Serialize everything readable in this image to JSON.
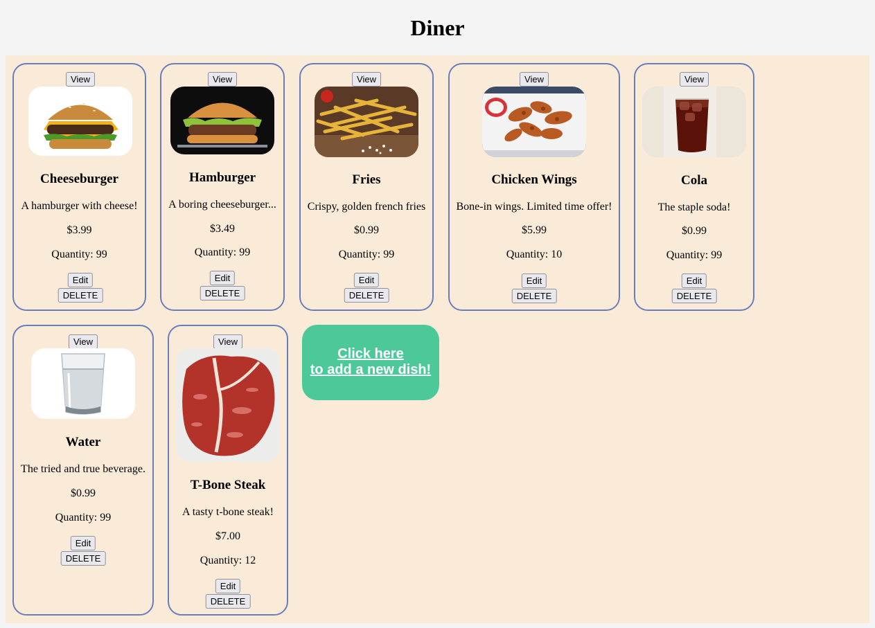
{
  "page": {
    "title": "Diner"
  },
  "buttons": {
    "view": "View",
    "edit": "Edit",
    "delete": "DELETE"
  },
  "dishes": [
    {
      "name": "Cheeseburger",
      "description": "A hamburger with cheese!",
      "price": "$3.99",
      "quantity_label": "Quantity:",
      "quantity": "99",
      "image": "cheeseburger-image"
    },
    {
      "name": "Hamburger",
      "description": "A boring cheeseburger...",
      "price": "$3.49",
      "quantity_label": "Quantity:",
      "quantity": "99",
      "image": "hamburger-image"
    },
    {
      "name": "Fries",
      "description": "Crispy, golden french fries",
      "price": "$0.99",
      "quantity_label": "Quantity:",
      "quantity": "99",
      "image": "fries-image"
    },
    {
      "name": "Chicken Wings",
      "description": "Bone-in wings. Limited time offer!",
      "price": "$5.99",
      "quantity_label": "Quantity:",
      "quantity": "10",
      "image": "chicken-wings-image"
    },
    {
      "name": "Cola",
      "description": "The staple soda!",
      "price": "$0.99",
      "quantity_label": "Quantity:",
      "quantity": "99",
      "image": "cola-image"
    },
    {
      "name": "Water",
      "description": "The tried and true beverage.",
      "price": "$0.99",
      "quantity_label": "Quantity:",
      "quantity": "99",
      "image": "water-image"
    },
    {
      "name": "T-Bone Steak",
      "description": "A tasty t-bone steak!",
      "price": "$7.00",
      "quantity_label": "Quantity:",
      "quantity": "12",
      "image": "steak-image"
    }
  ],
  "add_dish": {
    "line1": "Click here",
    "line2": "to add a new dish!"
  },
  "colors": {
    "page_bg": "#f4f4f4",
    "menu_bg": "#faebd8",
    "card_border": "#6a7dbb",
    "add_button_bg": "#4dc999"
  }
}
